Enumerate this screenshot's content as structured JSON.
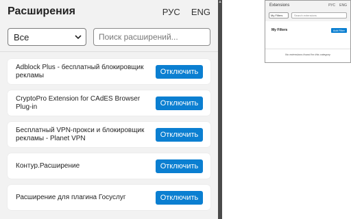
{
  "popup": {
    "title": "Расширения",
    "languages": [
      "РУС",
      "ENG"
    ],
    "filter_value": "Все",
    "search_placeholder": "Поиск расширений...",
    "extensions": [
      {
        "name": "Adblock Plus - бесплатный блокировщик рекламы",
        "button": "Отключить"
      },
      {
        "name": "CryptoPro Extension for CAdES Browser Plug-in",
        "button": "Отключить"
      },
      {
        "name": "Бесплатный VPN-прокси и блокировщик рекламы - Planet VPN",
        "button": "Отключить"
      },
      {
        "name": "Контур.Расширение",
        "button": "Отключить"
      },
      {
        "name": "Расширение для плагина Госуслуг",
        "button": "Отключить"
      }
    ]
  },
  "thumbnail": {
    "title": "Extensions",
    "languages": [
      "РУС",
      "ENG"
    ],
    "filter_value": "My Filters",
    "search_placeholder": "Search extensions",
    "filters_label": "My Filters",
    "add_button": "Add Filter",
    "empty_message": "No extensions found for this category"
  },
  "colors": {
    "accent": "#0b7fd1",
    "panel_bg": "#f2f2f2",
    "card_bg": "#ffffff",
    "scrollbar": "#4a4a4a"
  },
  "icons": {
    "dropdown": "chevron-down-icon"
  }
}
